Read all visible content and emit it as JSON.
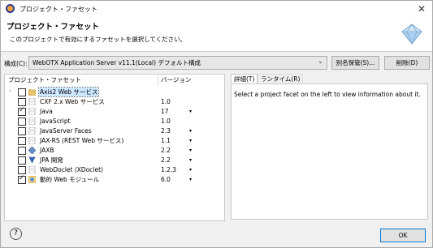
{
  "window": {
    "title": "プロジェクト・ファセット",
    "close_glyph": "✕"
  },
  "header": {
    "title": "プロジェクト・ファセット",
    "description": "このプロジェクトで有効にするファセットを選択してください。"
  },
  "configuration": {
    "label": "構成(C):",
    "selected": "WebOTX Application Server v11.1(Local) デフォルト構成",
    "save_as_label": "別名保管(S)...",
    "delete_label": "削除(D)"
  },
  "facets": {
    "column_name": "プロジェクト・ファセット",
    "column_version": "バージョン",
    "items": [
      {
        "name": "Axis2 Web サービス",
        "version": "",
        "checked": false,
        "expandable": true,
        "selected": true,
        "dropdown": false,
        "icon": "folder-icon"
      },
      {
        "name": "CXF 2.x Web サービス",
        "version": "1.0",
        "checked": false,
        "expandable": false,
        "selected": false,
        "dropdown": false,
        "icon": "document-icon"
      },
      {
        "name": "Java",
        "version": "17",
        "checked": true,
        "expandable": false,
        "selected": false,
        "dropdown": true,
        "icon": "document-icon"
      },
      {
        "name": "JavaScript",
        "version": "1.0",
        "checked": false,
        "expandable": false,
        "selected": false,
        "dropdown": false,
        "icon": "document-icon"
      },
      {
        "name": "JavaServer Faces",
        "version": "2.3",
        "checked": false,
        "expandable": false,
        "selected": false,
        "dropdown": true,
        "icon": "document-icon"
      },
      {
        "name": "JAX-RS (REST Web サービス)",
        "version": "1.1",
        "checked": false,
        "expandable": false,
        "selected": false,
        "dropdown": true,
        "icon": "document-icon"
      },
      {
        "name": "JAXB",
        "version": "2.2",
        "checked": false,
        "expandable": false,
        "selected": false,
        "dropdown": true,
        "icon": "jaxb-icon"
      },
      {
        "name": "JPA 開発",
        "version": "2.2",
        "checked": false,
        "expandable": false,
        "selected": false,
        "dropdown": true,
        "icon": "jpa-icon"
      },
      {
        "name": "WebDoclet (XDoclet)",
        "version": "1.2.3",
        "checked": false,
        "expandable": false,
        "selected": false,
        "dropdown": true,
        "icon": "document-icon"
      },
      {
        "name": "動的 Web モジュール",
        "version": "6.0",
        "checked": true,
        "expandable": false,
        "selected": false,
        "dropdown": true,
        "icon": "web-module-icon"
      }
    ]
  },
  "details": {
    "tabs": [
      {
        "label": "詳細(T)"
      },
      {
        "label": "ランタイム(R)"
      }
    ],
    "message": "Select a project facet on the left to view information about it."
  },
  "footer": {
    "help_glyph": "?",
    "ok_label": "OK"
  },
  "colors": {
    "selection": "#cce8ff",
    "border": "#c9c9c9",
    "background": "#f0f0f0"
  }
}
